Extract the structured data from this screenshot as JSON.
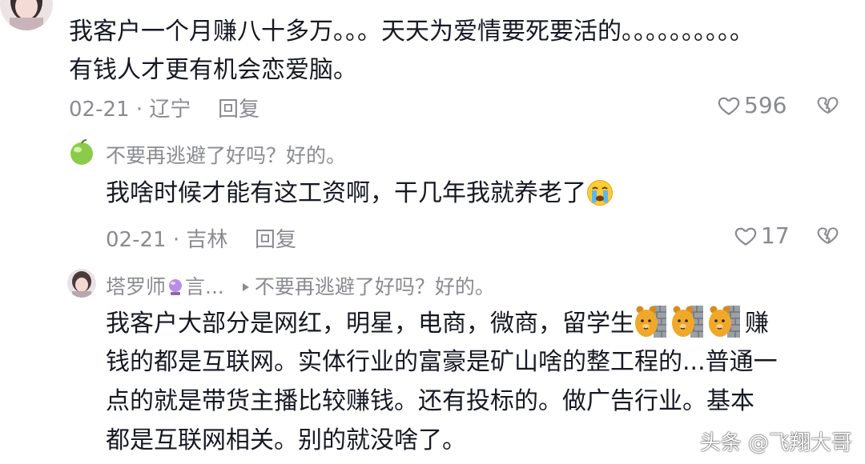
{
  "comments": [
    {
      "body_lines": [
        "我客户一个月赚八十多万。。。天天为爱情要死要活的。。。。。。。。。。",
        "有钱人才更有机会恋爱脑。"
      ],
      "date_location": "02-21 · 辽宁",
      "reply_label": "回复",
      "like_count": "596"
    },
    {
      "username": "不要再逃避了好吗？好的。",
      "body_text": "我啥时候才能有这工资啊，干几年我就养老了",
      "emoji": "crying-face-icon",
      "date_location": "02-21 · 吉林",
      "reply_label": "回复",
      "like_count": "17"
    },
    {
      "username": "塔罗师",
      "username_suffix": "言...",
      "reply_to": "不要再逃避了好吗？好的。",
      "body_lines": [
        "我客户大部分是网红，明星，电商，微商，留学生",
        "钱的都是互联网。实体行业的富豪是矿山啥的整工程的...普通一",
        "点的就是带货主播比较赚钱。还有投标的。做广告行业。基本",
        "都是互联网相关。别的就没啥了。"
      ],
      "line1_tail": "赚",
      "stickers": [
        "bear-wall-sticker",
        "bear-wall-sticker",
        "bear-wall-sticker"
      ]
    }
  ],
  "watermark": "头条 @飞翔大哥",
  "colors": {
    "text": "#161823",
    "muted": "#8a8b91"
  }
}
